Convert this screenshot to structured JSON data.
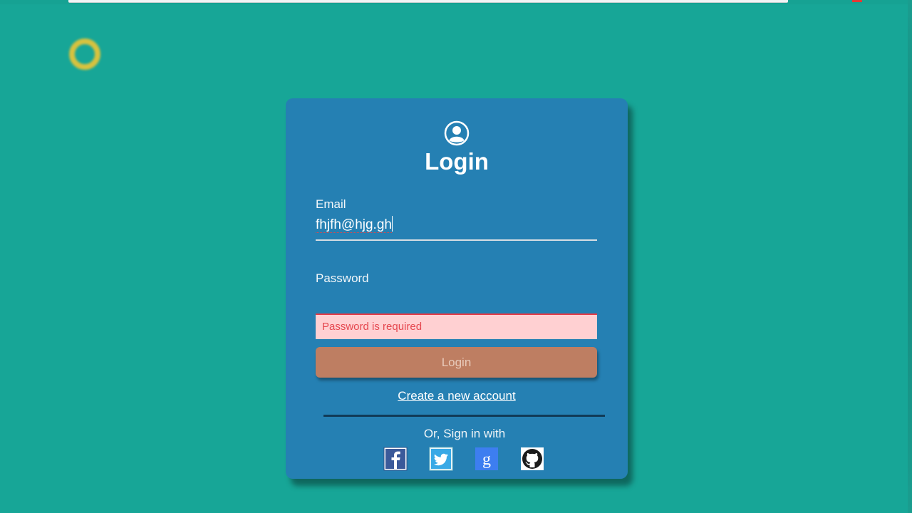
{
  "login": {
    "title": "Login",
    "email_label": "Email",
    "email_value": "fhjfh@hjg.gh",
    "password_label": "Password",
    "password_error": "Password is required",
    "login_button": "Login",
    "create_account_link": "Create a new account",
    "social_prompt": "Or, Sign in with"
  },
  "icons": [
    "user-circle-icon",
    "facebook-icon",
    "twitter-icon",
    "google-icon",
    "github-icon",
    "loading-ring-icon"
  ],
  "colors": {
    "background": "#17a697",
    "card": "#2580b3",
    "button": "#be7e62",
    "error_bg": "#ffd0d2",
    "error_text": "#e5474f"
  }
}
